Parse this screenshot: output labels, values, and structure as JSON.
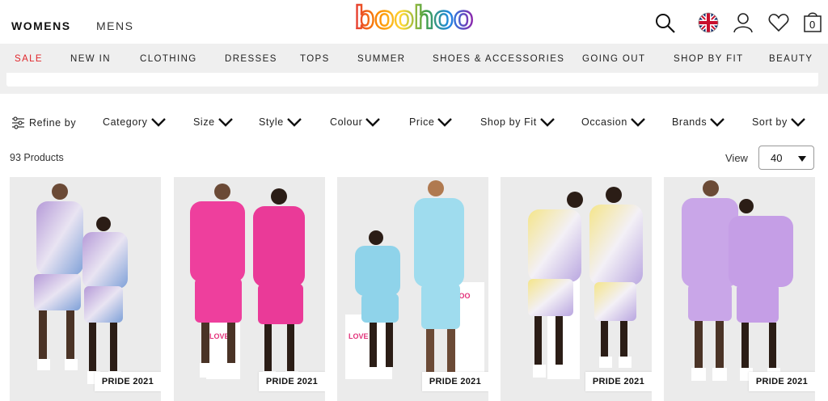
{
  "header": {
    "womens": "WOMENS",
    "mens": "MENS",
    "logo_text": "boohoo",
    "cart_count": "0"
  },
  "nav": {
    "items": [
      "SALE",
      "NEW IN",
      "CLOTHING",
      "DRESSES",
      "TOPS",
      "SUMMER",
      "SHOES & ACCESSORIES",
      "GOING OUT",
      "SHOP BY FIT",
      "BEAUTY"
    ],
    "sale_color": "#e0262b"
  },
  "filters": {
    "refine": "Refine by",
    "items": [
      "Category",
      "Size",
      "Style",
      "Colour",
      "Price",
      "Shop by Fit",
      "Occasion",
      "Brands",
      "Sort by"
    ]
  },
  "results": {
    "count": "93 Products",
    "view_label": "View",
    "view_value": "40"
  },
  "products": [
    {
      "badge": "PRIDE 2021",
      "color": "tie-dye purple/blue"
    },
    {
      "badge": "PRIDE 2021",
      "color": "hot pink"
    },
    {
      "badge": "PRIDE 2021",
      "color": "light blue"
    },
    {
      "badge": "PRIDE 2021",
      "color": "tie-dye yellow"
    },
    {
      "badge": "PRIDE 2021",
      "color": "lilac"
    }
  ]
}
